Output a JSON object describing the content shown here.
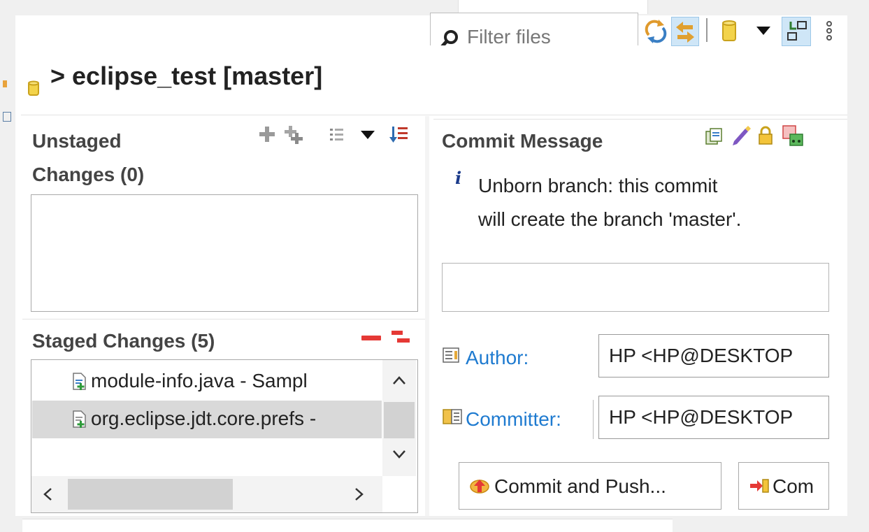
{
  "filter": {
    "placeholder": "Filter files"
  },
  "repo": {
    "title": "> eclipse_test [master]"
  },
  "unstaged": {
    "title_line1": "Unstaged",
    "title_line2": "Changes (0)"
  },
  "staged": {
    "title": "Staged Changes (5)",
    "files": [
      {
        "label": "module-info.java - Sampl",
        "icon": "java-file-add-icon"
      },
      {
        "label": "org.eclipse.jdt.core.prefs -",
        "icon": "file-add-icon"
      }
    ]
  },
  "commit": {
    "title": "Commit Message",
    "info_line1": "Unborn branch: this commit",
    "info_line2": "will create the branch 'master'.",
    "message_value": "",
    "author_label": "Author:",
    "author_value": "HP <HP@DESKTOP",
    "committer_label": "Committer:",
    "committer_value": "HP <HP@DESKTOP",
    "commit_push_label": "Commit and Push...",
    "commit_label": "Com"
  },
  "colors": {
    "link": "#1f7bd0",
    "remove_red": "#e53935",
    "selection": "#d9d9d9"
  }
}
